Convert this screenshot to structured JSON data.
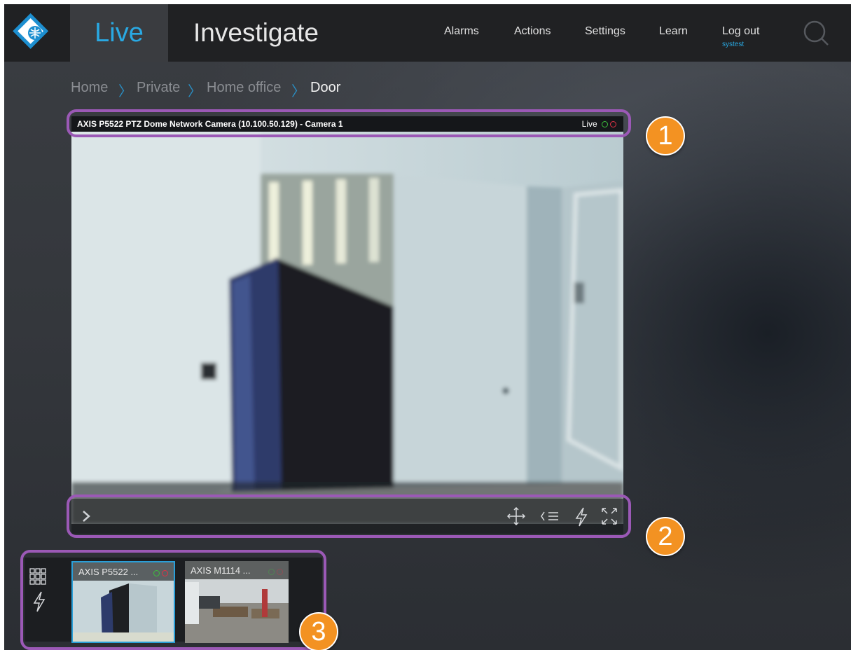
{
  "topbar": {
    "tab_live": "Live",
    "tab_investigate": "Investigate",
    "nav": [
      "Alarms",
      "Actions",
      "Settings",
      "Learn",
      "Log out"
    ],
    "user": "systest"
  },
  "breadcrumb": [
    "Home",
    "Private",
    "Home office",
    "Door"
  ],
  "camera": {
    "title": "AXIS P5522 PTZ Dome Network Camera (10.100.50.129) - Camera 1",
    "status": "Live"
  },
  "thumbnails": [
    {
      "label": "AXIS P5522 ..."
    },
    {
      "label": "AXIS M1114 ..."
    }
  ],
  "callouts": [
    "1",
    "2",
    "3"
  ],
  "colors": {
    "accent": "#29a9e3",
    "highlight": "#9b59b6",
    "badge": "#f39222",
    "status_green": "#3cbf3c",
    "status_red": "#e03146"
  },
  "icons": [
    "logo-icon",
    "search-icon",
    "expand-panel-icon",
    "ptz-move-icon",
    "presets-icon",
    "trigger-action-icon",
    "fullscreen-icon",
    "grid-view-icon",
    "trigger-icon"
  ]
}
